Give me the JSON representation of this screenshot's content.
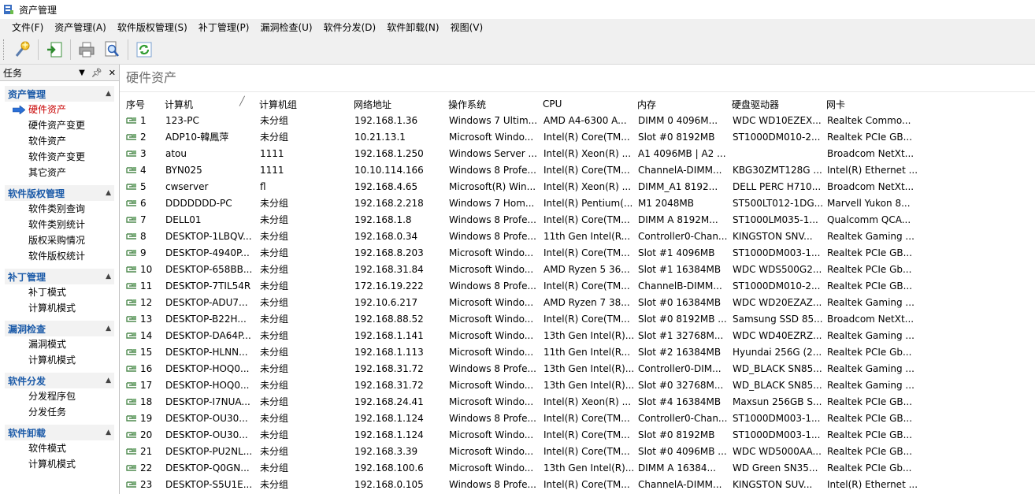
{
  "window": {
    "title": "资产管理"
  },
  "menu": [
    "文件(F)",
    "资产管理(A)",
    "软件版权管理(S)",
    "补丁管理(P)",
    "漏洞检查(U)",
    "软件分发(D)",
    "软件卸载(N)",
    "视图(V)"
  ],
  "task_panel": {
    "title": "任务",
    "pin_glyph": "▾ ▪ ✕",
    "groups": [
      {
        "title": "资产管理",
        "items": [
          "硬件资产",
          "硬件资产变更",
          "软件资产",
          "软件资产变更",
          "其它资产"
        ]
      },
      {
        "title": "软件版权管理",
        "items": [
          "软件类别查询",
          "软件类别统计",
          "版权采购情况",
          "软件版权统计"
        ]
      },
      {
        "title": "补丁管理",
        "items": [
          "补丁模式",
          "计算机模式"
        ]
      },
      {
        "title": "漏洞检查",
        "items": [
          "漏洞模式",
          "计算机模式"
        ]
      },
      {
        "title": "软件分发",
        "items": [
          "分发程序包",
          "分发任务"
        ]
      },
      {
        "title": "软件卸载",
        "items": [
          "软件模式",
          "计算机模式"
        ]
      }
    ]
  },
  "main": {
    "title": "硬件资产",
    "columns": [
      "序号",
      "计算机",
      "计算机组",
      "网络地址",
      "操作系统",
      "CPU",
      "内存",
      "硬盘驱动器",
      "网卡"
    ],
    "rows": [
      [
        "1",
        "123-PC",
        "未分组",
        "192.168.1.36",
        "Windows 7 Ultim...",
        "AMD A4-6300 A...",
        "DIMM 0 4096M...",
        "WDC WD10EZEX...",
        "Realtek Commo..."
      ],
      [
        "2",
        "ADP10-韓鳳萍",
        "未分组",
        "10.21.13.1",
        "Microsoft Windo...",
        "Intel(R) Core(TM...",
        "Slot #0 8192MB",
        "ST1000DM010-2...",
        "Realtek PCIe GB..."
      ],
      [
        "3",
        "atou",
        "1111",
        "192.168.1.250",
        "Windows Server ...",
        "Intel(R) Xeon(R) ...",
        "A1 4096MB | A2 ...",
        "",
        "Broadcom NetXt..."
      ],
      [
        "4",
        "BYN025",
        "1111",
        "10.10.114.166",
        "Windows 8 Profe...",
        "Intel(R) Core(TM...",
        "ChannelA-DIMM...",
        "KBG30ZMT128G ...",
        "Intel(R) Ethernet ..."
      ],
      [
        "5",
        "cwserver",
        "fl",
        "192.168.4.65",
        "Microsoft(R) Win...",
        "Intel(R) Xeon(R) ...",
        "DIMM_A1  8192...",
        "DELL PERC H710...",
        "Broadcom NetXt..."
      ],
      [
        "6",
        "DDDDDDD-PC",
        "未分组",
        "192.168.2.218",
        "Windows 7 Hom...",
        "Intel(R) Pentium(...",
        "M1 2048MB",
        "ST500LT012-1DG...",
        "Marvell Yukon 8..."
      ],
      [
        "7",
        "DELL01",
        "未分组",
        "192.168.1.8",
        "Windows 8 Profe...",
        "Intel(R) Core(TM...",
        "DIMM A 8192M...",
        "ST1000LM035-1...",
        "Qualcomm QCA..."
      ],
      [
        "8",
        "DESKTOP-1LBQV...",
        "未分组",
        "192.168.0.34",
        "Windows 8 Profe...",
        "11th Gen Intel(R...",
        "Controller0-Chan...",
        "KINGSTON SNV...",
        "Realtek Gaming ..."
      ],
      [
        "9",
        "DESKTOP-4940P...",
        "未分组",
        "192.168.8.203",
        "Microsoft Windo...",
        "Intel(R) Core(TM...",
        "Slot #1 4096MB",
        "ST1000DM003-1...",
        "Realtek PCIe GB..."
      ],
      [
        "10",
        "DESKTOP-658BB...",
        "未分组",
        "192.168.31.84",
        "Microsoft Windo...",
        "AMD Ryzen 5 36...",
        "Slot #1 16384MB",
        "WDC WDS500G2...",
        "Realtek PCIe Gb..."
      ],
      [
        "11",
        "DESKTOP-7TIL54R",
        "未分组",
        "172.16.19.222",
        "Windows 8 Profe...",
        "Intel(R) Core(TM...",
        "ChannelB-DIMM...",
        "ST1000DM010-2...",
        "Realtek PCIe GB..."
      ],
      [
        "12",
        "DESKTOP-ADU7...",
        "未分组",
        "192.10.6.217",
        "Microsoft Windo...",
        "AMD Ryzen 7 38...",
        "Slot #0 16384MB",
        "WDC WD20EZAZ...",
        "Realtek Gaming ..."
      ],
      [
        "13",
        "DESKTOP-B22H...",
        "未分组",
        "192.168.88.52",
        "Microsoft Windo...",
        "Intel(R) Core(TM...",
        "Slot #0 8192MB ...",
        "Samsung SSD 85...",
        "Broadcom NetXt..."
      ],
      [
        "14",
        "DESKTOP-DA64P...",
        "未分组",
        "192.168.1.141",
        "Microsoft Windo...",
        "13th Gen Intel(R)...",
        "Slot #1 32768M...",
        "WDC WD40EZRZ...",
        "Realtek Gaming ..."
      ],
      [
        "15",
        "DESKTOP-HLNN...",
        "未分组",
        "192.168.1.113",
        "Microsoft Windo...",
        "11th Gen Intel(R...",
        "Slot #2 16384MB",
        "Hyundai 256G (2...",
        "Realtek PCIe Gb..."
      ],
      [
        "16",
        "DESKTOP-HOQ0...",
        "未分组",
        "192.168.31.72",
        "Windows 8 Profe...",
        "13th Gen Intel(R)...",
        "Controller0-DIM...",
        "WD_BLACK SN85...",
        "Realtek Gaming ..."
      ],
      [
        "17",
        "DESKTOP-HOQ0...",
        "未分组",
        "192.168.31.72",
        "Microsoft Windo...",
        "13th Gen Intel(R)...",
        "Slot #0 32768M...",
        "WD_BLACK SN85...",
        "Realtek Gaming ..."
      ],
      [
        "18",
        "DESKTOP-I7NUA...",
        "未分组",
        "192.168.24.41",
        "Microsoft Windo...",
        "Intel(R) Xeon(R) ...",
        "Slot #4 16384MB",
        "Maxsun 256GB S...",
        "Realtek PCIe GB..."
      ],
      [
        "19",
        "DESKTOP-OU30...",
        "未分组",
        "192.168.1.124",
        "Windows 8 Profe...",
        "Intel(R) Core(TM...",
        "Controller0-Chan...",
        "ST1000DM003-1...",
        "Realtek PCIe GB..."
      ],
      [
        "20",
        "DESKTOP-OU30...",
        "未分组",
        "192.168.1.124",
        "Microsoft Windo...",
        "Intel(R) Core(TM...",
        "Slot #0 8192MB",
        "ST1000DM003-1...",
        "Realtek PCIe GB..."
      ],
      [
        "21",
        "DESKTOP-PU2NL...",
        "未分组",
        "192.168.3.39",
        "Microsoft Windo...",
        "Intel(R) Core(TM...",
        "Slot #0 4096MB ...",
        "WDC WD5000AA...",
        "Realtek PCIe GB..."
      ],
      [
        "22",
        "DESKTOP-Q0GN...",
        "未分组",
        "192.168.100.6",
        "Microsoft Windo...",
        "13th Gen Intel(R)...",
        "DIMM A 16384...",
        "WD Green SN35...",
        "Realtek PCIe Gb..."
      ],
      [
        "23",
        "DESKTOP-S5U1E...",
        "未分组",
        "192.168.0.105",
        "Windows 8 Profe...",
        "Intel(R) Core(TM...",
        "ChannelA-DIMM...",
        "KINGSTON SUV...",
        "Intel(R) Ethernet ..."
      ]
    ]
  },
  "colors": {
    "accent": "#1b5aa8",
    "active_item": "#c80000",
    "panel_bg": "#f0f0f0"
  },
  "icons": {
    "toolbar": [
      "search-wand-icon",
      "export-icon",
      "print-icon",
      "print-preview-icon",
      "refresh-icon"
    ],
    "row": "computer-network-icon"
  }
}
